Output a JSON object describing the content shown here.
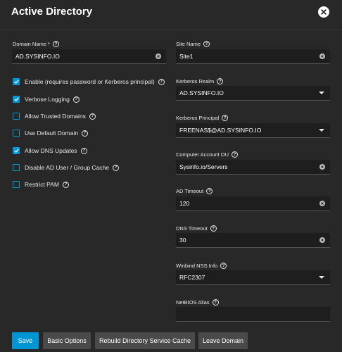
{
  "dialog": {
    "title": "Active Directory"
  },
  "left": {
    "domain_name": {
      "label": "Domain Name *",
      "value": "AD.SYSINFO.IO"
    },
    "checkboxes": [
      {
        "label": "Enable (requires password or Kerberos principal)",
        "checked": true,
        "help": true
      },
      {
        "label": "Verbose Logging",
        "checked": true,
        "help": true
      },
      {
        "label": "Allow Trusted Domains",
        "checked": false,
        "help": true
      },
      {
        "label": "Use Default Domain",
        "checked": false,
        "help": true
      },
      {
        "label": "Allow DNS Updates",
        "checked": true,
        "help": true
      },
      {
        "label": "Disable AD User / Group Cache",
        "checked": false,
        "help": true
      },
      {
        "label": "Restrict PAM",
        "checked": false,
        "help": true
      }
    ]
  },
  "right": {
    "site_name": {
      "label": "Site Name",
      "value": "Site1"
    },
    "kerberos_realm": {
      "label": "Kerberos Realm",
      "value": "AD.SYSINFO.IO"
    },
    "kerberos_principal": {
      "label": "Kerberos Principal",
      "value": "FREENAS$@AD.SYSINFO.IO"
    },
    "computer_account_ou": {
      "label": "Computer Account OU",
      "value": "Sysinfo.io/Servers"
    },
    "ad_timeout": {
      "label": "AD Timeout",
      "value": "120"
    },
    "dns_timeout": {
      "label": "DNS Timeout",
      "value": "30"
    },
    "winbind_nss_info": {
      "label": "Winbind NSS Info",
      "value": "RFC2307"
    },
    "netbios_alias": {
      "label": "NetBIOS Alias",
      "value": ""
    }
  },
  "actions": {
    "save": "Save",
    "basic_options": "Basic Options",
    "rebuild_cache": "Rebuild Directory Service Cache",
    "leave_domain": "Leave Domain"
  },
  "colors": {
    "accent": "#0095d5",
    "background": "#282828",
    "input_bg": "#1e1e1e"
  },
  "icons": [
    "close-icon",
    "help-icon",
    "clear-icon",
    "caret-down-icon",
    "check-icon"
  ]
}
